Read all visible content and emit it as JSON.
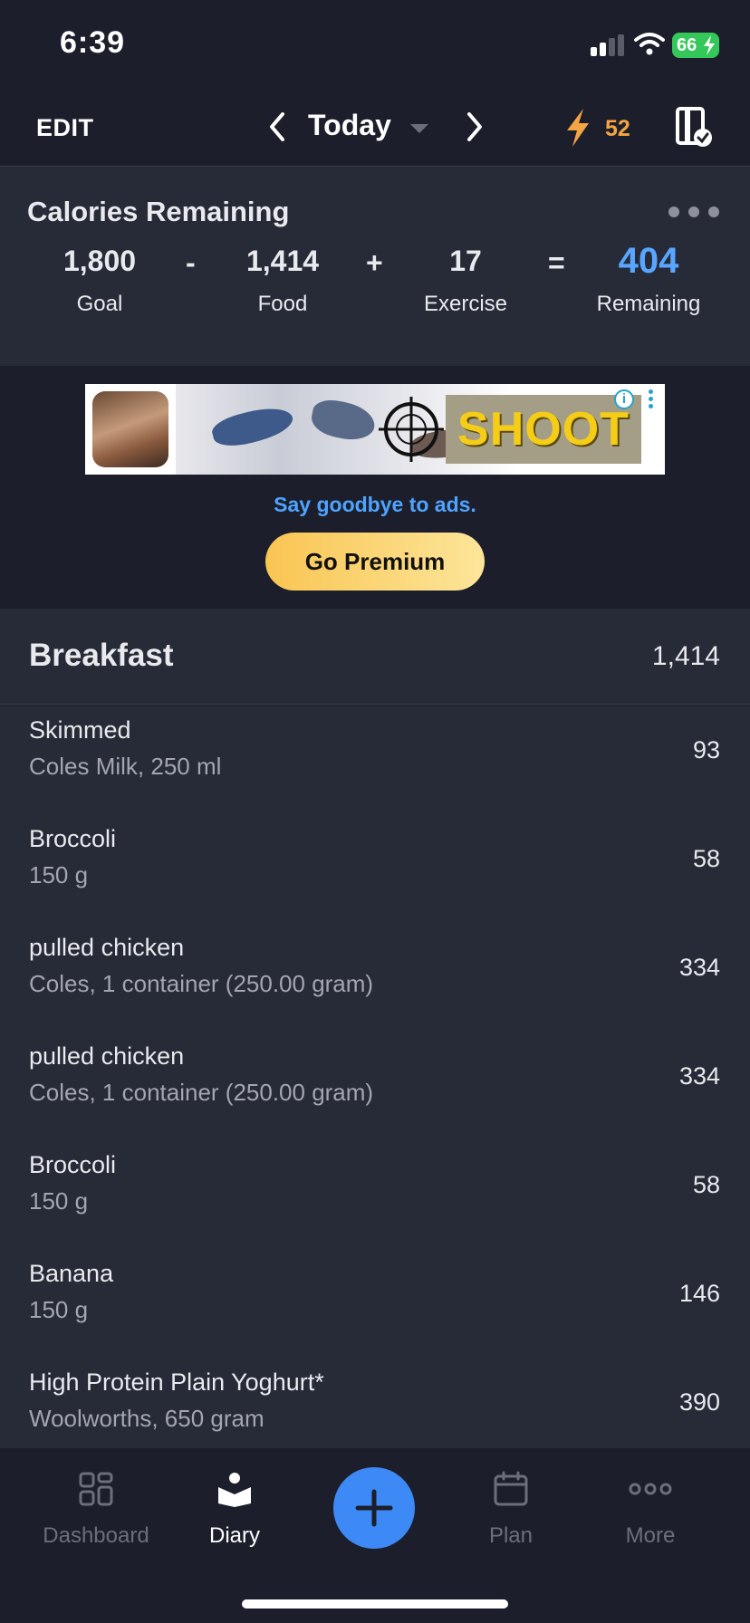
{
  "status_bar": {
    "time": "6:39",
    "battery": "66"
  },
  "header": {
    "edit_label": "EDIT",
    "date_label": "Today",
    "streak_count": "52"
  },
  "calories": {
    "title": "Calories Remaining",
    "goal_value": "1,800",
    "goal_label": "Goal",
    "minus": "-",
    "food_value": "1,414",
    "food_label": "Food",
    "plus": "+",
    "exercise_value": "17",
    "exercise_label": "Exercise",
    "equals": "=",
    "remaining_value": "404",
    "remaining_label": "Remaining"
  },
  "ad": {
    "banner_text": "SHOOT",
    "info_glyph": "i",
    "tagline": "Say goodbye to ads.",
    "premium_label": "Go Premium"
  },
  "meal": {
    "title": "Breakfast",
    "total": "1,414",
    "items": [
      {
        "name": "Skimmed",
        "detail": "Coles Milk, 250 ml",
        "calories": "93"
      },
      {
        "name": "Broccoli",
        "detail": "150 g",
        "calories": "58"
      },
      {
        "name": "pulled chicken",
        "detail": "Coles, 1 container (250.00 gram)",
        "calories": "334"
      },
      {
        "name": "pulled chicken",
        "detail": "Coles, 1 container (250.00 gram)",
        "calories": "334"
      },
      {
        "name": "Broccoli",
        "detail": "150 g",
        "calories": "58"
      },
      {
        "name": "Banana",
        "detail": "150 g",
        "calories": "146"
      },
      {
        "name": "High Protein Plain Yoghurt*",
        "detail": "Woolworths, 650 gram",
        "calories": "390"
      }
    ]
  },
  "tabs": {
    "dashboard": "Dashboard",
    "diary": "Diary",
    "plan": "Plan",
    "more": "More"
  },
  "colors": {
    "background": "#1c1f2b",
    "card": "#272a37",
    "accent_blue": "#58a6ff",
    "streak_orange": "#f5a442",
    "premium_yellow": "#f9c552",
    "fab_blue": "#3d8af7"
  },
  "icons": [
    "signal-icon",
    "wifi-icon",
    "battery-icon",
    "chevron-left-icon",
    "caret-down-icon",
    "chevron-right-icon",
    "lightning-icon",
    "log-complete-icon",
    "more-dots-icon",
    "info-icon",
    "kebab-icon",
    "dashboard-grid-icon",
    "diary-book-icon",
    "plus-icon",
    "calendar-icon",
    "more-dots-icon"
  ]
}
